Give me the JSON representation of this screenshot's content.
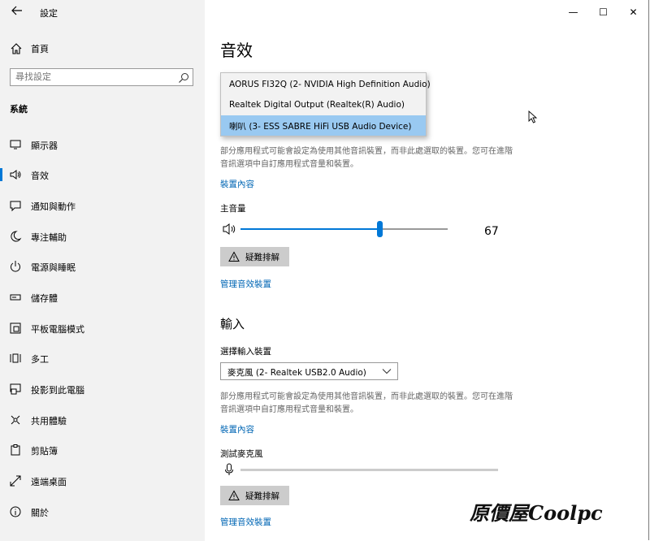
{
  "window": {
    "title": "設定",
    "controls": {
      "minimize": "—",
      "maximize": "☐",
      "close": "✕"
    }
  },
  "sidebar": {
    "home_label": "首頁",
    "search_placeholder": "尋找設定",
    "section_label": "系統",
    "items": [
      {
        "label": "顯示器",
        "icon": "monitor-icon"
      },
      {
        "label": "音效",
        "icon": "speaker-icon",
        "active": true
      },
      {
        "label": "通知與動作",
        "icon": "notification-icon"
      },
      {
        "label": "專注輔助",
        "icon": "moon-icon"
      },
      {
        "label": "電源與睡眠",
        "icon": "power-icon"
      },
      {
        "label": "儲存體",
        "icon": "storage-icon"
      },
      {
        "label": "平板電腦模式",
        "icon": "tablet-icon"
      },
      {
        "label": "多工",
        "icon": "multitask-icon"
      },
      {
        "label": "投影到此電腦",
        "icon": "project-icon"
      },
      {
        "label": "共用體驗",
        "icon": "shared-icon"
      },
      {
        "label": "剪貼簿",
        "icon": "clipboard-icon"
      },
      {
        "label": "遠端桌面",
        "icon": "remote-desktop-icon"
      },
      {
        "label": "關於",
        "icon": "info-icon"
      }
    ]
  },
  "main": {
    "title": "音效",
    "output": {
      "dropdown_options": [
        "AORUS FI32Q (2- NVIDIA High Definition Audio)",
        "Realtek Digital Output (Realtek(R) Audio)",
        "喇叭 (3- ESS SABRE HiFi USB Audio Device)"
      ],
      "selected_index": 2,
      "description": "部分應用程式可能會設定為使用其他音訊裝置，而非此處選取的裝置。您可在進階音訊選項中自訂應用程式音量和裝置。",
      "device_properties_link": "裝置內容",
      "master_volume_label": "主音量",
      "volume": 67,
      "troubleshoot_label": "疑難排解",
      "manage_devices_link": "管理音效裝置"
    },
    "input": {
      "heading": "輸入",
      "choose_label": "選擇輸入裝置",
      "selected_device": "麥克風 (2- Realtek USB2.0 Audio)",
      "description": "部分應用程式可能會設定為使用其他音訊裝置，而非此處選取的裝置。您可在進階音訊選項中自訂應用程式音量和裝置。",
      "device_properties_link": "裝置內容",
      "test_mic_label": "測試麥克風",
      "troubleshoot_label": "疑難排解",
      "manage_devices_link": "管理音效裝置"
    }
  },
  "watermark": {
    "text": "原價屋Coolpc"
  },
  "colors": {
    "accent": "#0078d7",
    "link": "#0066b4",
    "selected_option": "#99c9f1"
  }
}
